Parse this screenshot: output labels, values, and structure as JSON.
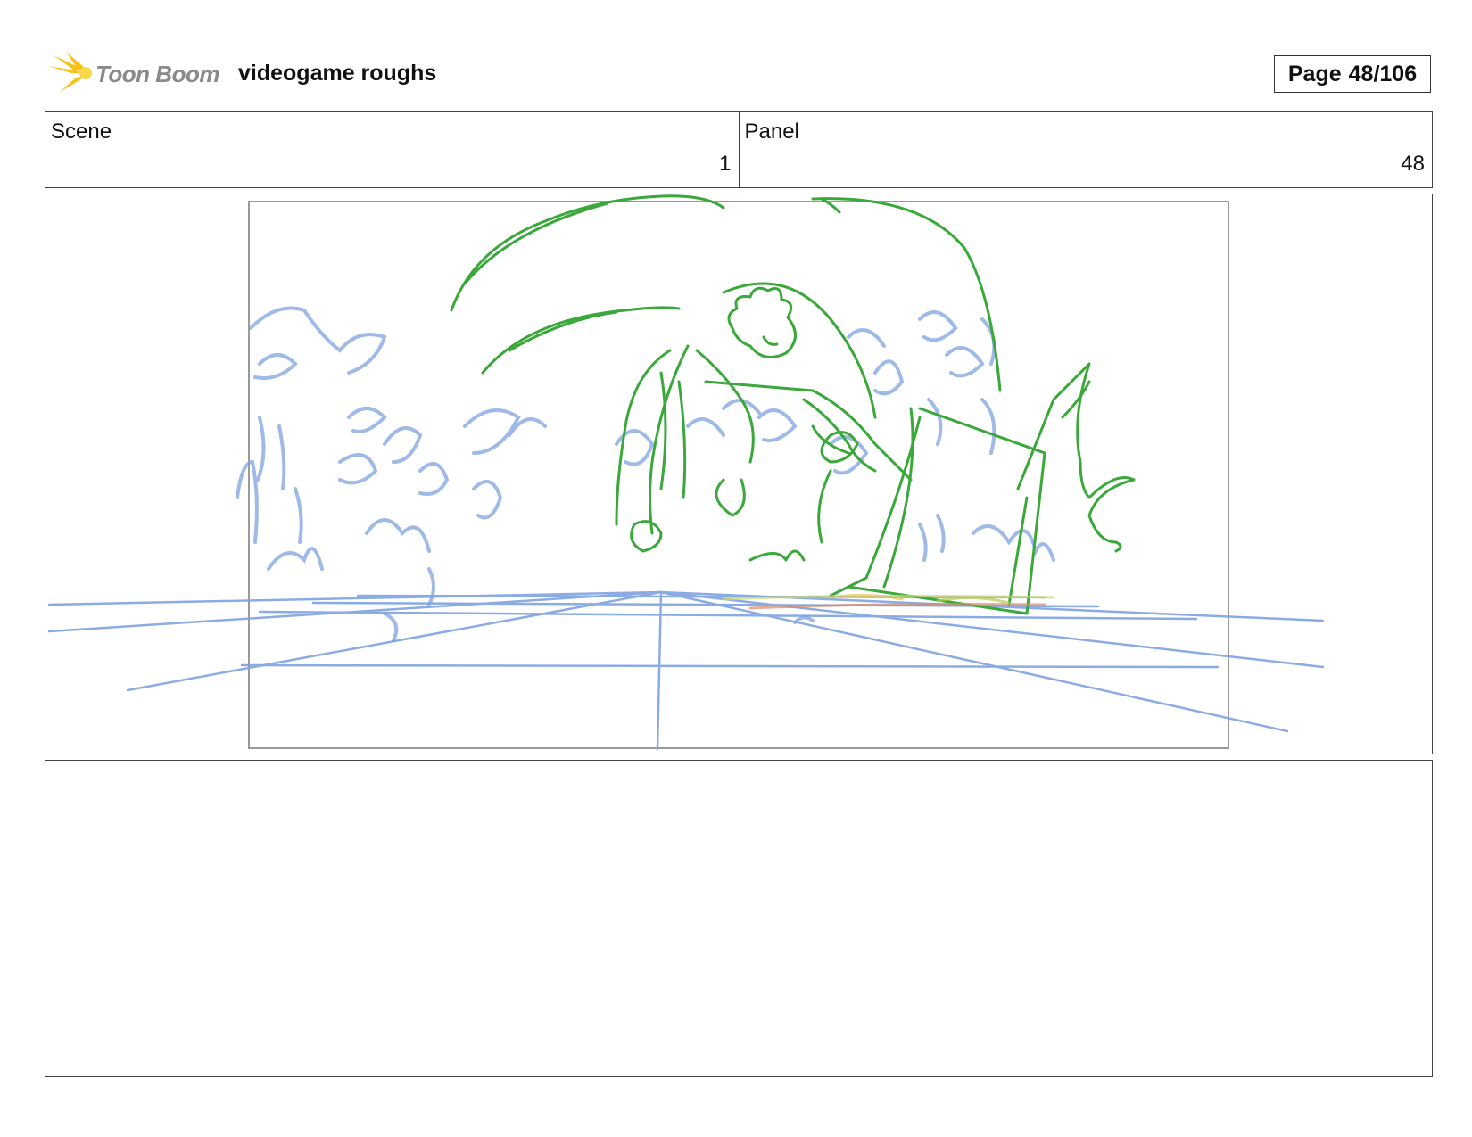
{
  "header": {
    "brand": "Toon Boom",
    "project_title": "videogame roughs",
    "page_label": "Page",
    "page_number": "48/106"
  },
  "info": {
    "scene_label": "Scene",
    "scene_value": "1",
    "panel_label": "Panel",
    "panel_value": "48"
  },
  "colors": {
    "sketch_blue": "#7fa3e0",
    "sketch_green": "#3aa83a",
    "frame_gray": "#9a9a9a",
    "logo_yellow": "#f6c21a"
  },
  "notes": {
    "text": ""
  }
}
